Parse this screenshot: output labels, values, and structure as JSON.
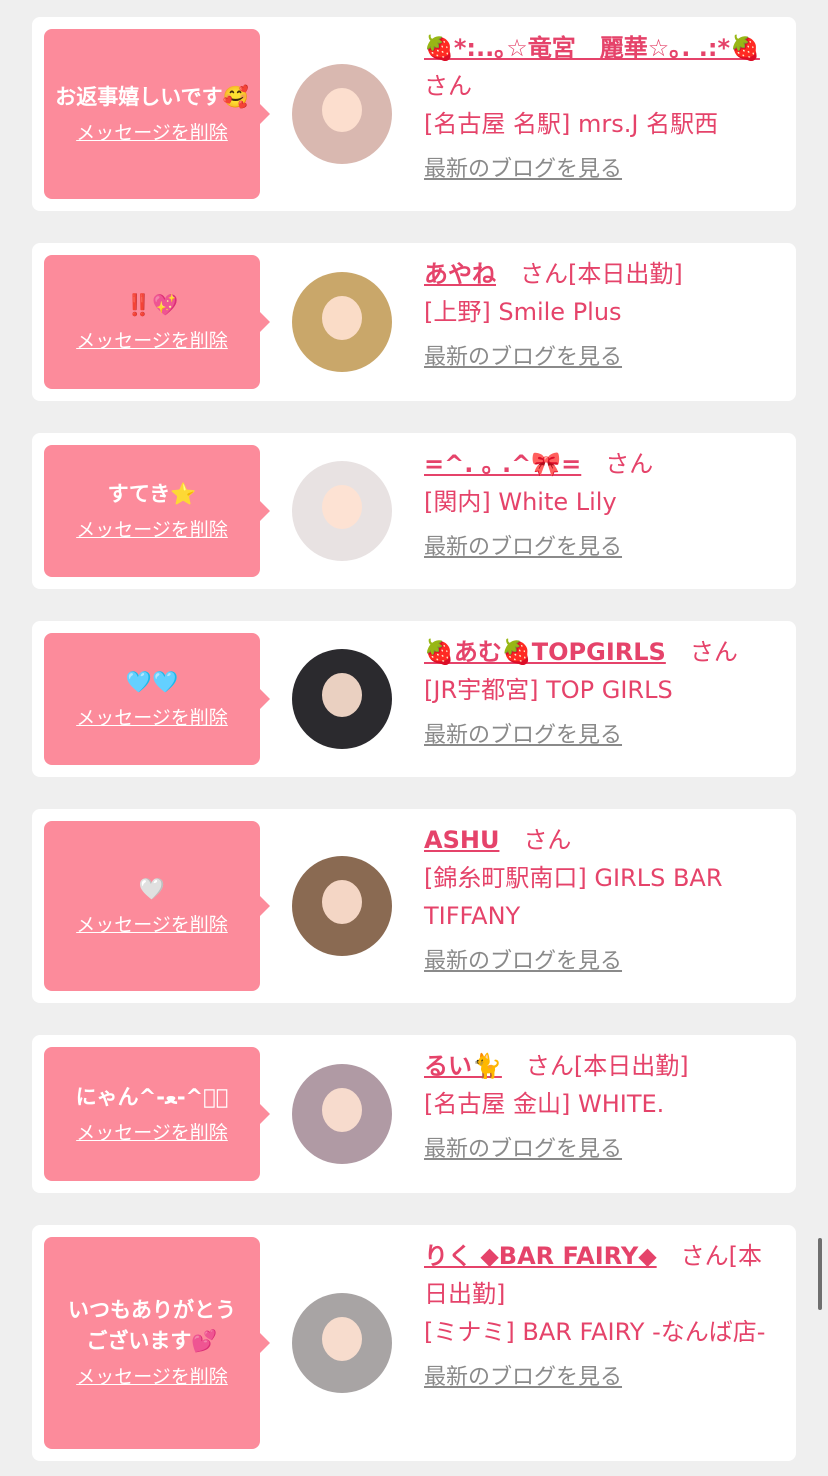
{
  "messages": [
    {
      "message": "お返事嬉しいです🥰",
      "delete_label": "メッセージを削除",
      "name": "🍓*:..｡☆竜宮　麗華☆｡. .:*🍓",
      "suffix": "さん",
      "shop": "[名古屋 名駅] mrs.J 名駅西",
      "blog_label": "最新のブログを見る",
      "avatar_color": "#d9b8b0"
    },
    {
      "message": "‼️💖",
      "delete_label": "メッセージを削除",
      "name": "あやね",
      "suffix": "さん[本日出勤]",
      "shop": "[上野] Smile Plus",
      "blog_label": "最新のブログを見る",
      "avatar_color": "#c9a76a"
    },
    {
      "message": "すてき⭐️",
      "delete_label": "メッセージを削除",
      "name": "=^. ｡ .^🎀=",
      "suffix": "さん",
      "shop": "[関内] White Lily",
      "blog_label": "最新のブログを見る",
      "avatar_color": "#e8e2e2"
    },
    {
      "message": "🩵🩵",
      "delete_label": "メッセージを削除",
      "name": "🍓あむ🍓TOPGIRLS",
      "suffix": "さん",
      "shop": "[JR宇都宮] TOP GIRLS",
      "blog_label": "最新のブログを見る",
      "avatar_color": "#2b2a2e"
    },
    {
      "message": "🤍",
      "delete_label": "メッセージを削除",
      "name": "ASHU",
      "suffix": "さん",
      "shop": "[錦糸町駅南口] GIRLS BAR TIFFANY",
      "blog_label": "最新のブログを見る",
      "avatar_color": "#8a6a52"
    },
    {
      "message": "にゃん^-ﻌ-^ฅ゙",
      "delete_label": "メッセージを削除",
      "name": "るい🐈",
      "suffix": "さん[本日出勤]",
      "shop": "[名古屋 金山] WHITE.",
      "blog_label": "最新のブログを見る",
      "avatar_color": "#b09aa4"
    },
    {
      "message": "いつもありがとう\nございます💕",
      "delete_label": "メッセージを削除",
      "name": "りく ◆BAR FAIRY◆",
      "suffix": "さん[本日出勤]",
      "shop": "[ミナミ] BAR FAIRY -なんば店-",
      "blog_label": "最新のブログを見る",
      "avatar_color": "#a8a4a4"
    }
  ]
}
